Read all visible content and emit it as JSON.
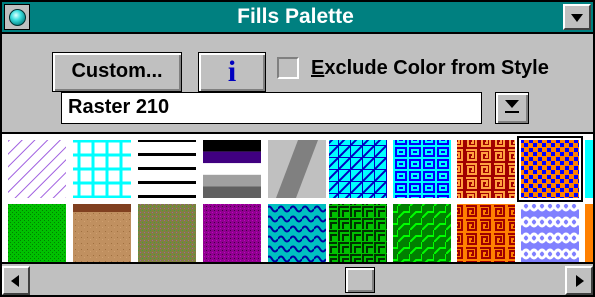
{
  "window": {
    "title": "Fills Palette",
    "title_bar_color": "#008080"
  },
  "toolbar": {
    "custom_label": "Custom...",
    "info_icon": "info-icon",
    "exclude_color": {
      "checked": false,
      "label_underlined": "E",
      "label_rest": "xclude Color from Style"
    }
  },
  "fill_selector": {
    "value": "Raster 210",
    "dropdown_icon": "dropdown-arrow-icon"
  },
  "fills": [
    {
      "name": "diagonal-lines-violet",
      "row": 1,
      "selected": false
    },
    {
      "name": "grid-cyan",
      "row": 1,
      "selected": false
    },
    {
      "name": "horizontal-lines-black",
      "row": 1,
      "selected": false
    },
    {
      "name": "gradient-bands-purple-gray",
      "row": 1,
      "selected": false
    },
    {
      "name": "diagonal-stripe-gray",
      "row": 1,
      "selected": false
    },
    {
      "name": "zigzag-blue-cyan",
      "row": 1,
      "selected": false
    },
    {
      "name": "brick-blue-cyan",
      "row": 1,
      "selected": false
    },
    {
      "name": "spiral-red-orange",
      "row": 1,
      "selected": false
    },
    {
      "name": "dots-blue-orange",
      "row": 1,
      "selected": true
    },
    {
      "name": "cyan-partial",
      "row": 1,
      "selected": false
    },
    {
      "name": "noise-green",
      "row": 2,
      "selected": false
    },
    {
      "name": "sand-tan",
      "row": 2,
      "selected": false
    },
    {
      "name": "noise-olive",
      "row": 2,
      "selected": false
    },
    {
      "name": "noise-purple",
      "row": 2,
      "selected": false
    },
    {
      "name": "waves-cyan-blue",
      "row": 2,
      "selected": false
    },
    {
      "name": "zigzag-green",
      "row": 2,
      "selected": false
    },
    {
      "name": "steps-green",
      "row": 2,
      "selected": false
    },
    {
      "name": "spiral-orange-brown",
      "row": 2,
      "selected": false
    },
    {
      "name": "waves-blue-violet",
      "row": 2,
      "selected": false
    },
    {
      "name": "orange-partial",
      "row": 2,
      "selected": false
    }
  ],
  "scrollbar": {
    "left_icon": "arrow-left-icon",
    "right_icon": "arrow-right-icon",
    "position_fraction": 0.6
  }
}
